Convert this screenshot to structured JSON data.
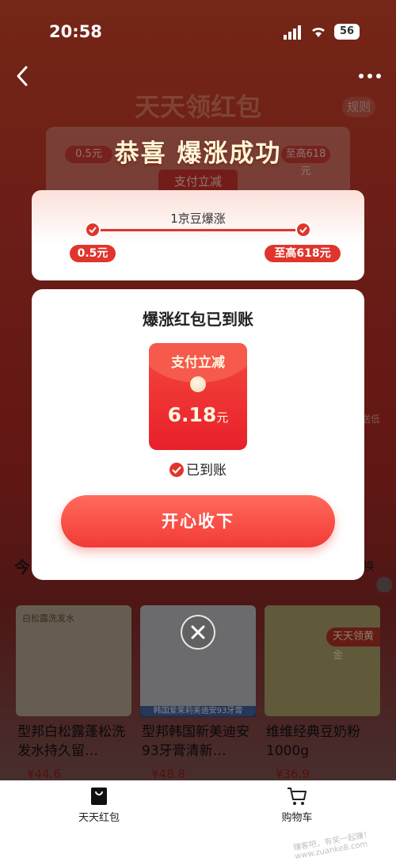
{
  "status_bar": {
    "time": "20:58",
    "battery": "56"
  },
  "header": {
    "title": "天天领红包",
    "rules_label": "规则",
    "back_icon": "chevron-left-icon",
    "more_icon": "more-dots-icon"
  },
  "background_card": {
    "low_value": "0.5元",
    "high_value": "至高618元",
    "button_label": "支付立减"
  },
  "congrats": {
    "title": "恭喜  爆涨成功"
  },
  "progress": {
    "label": "1京豆爆涨",
    "start_value": "0.5元",
    "end_value": "至高618元"
  },
  "reward": {
    "title": "爆涨红包已到账",
    "envelope_label": "支付立减",
    "amount": "6.18",
    "unit": "元",
    "received_label": "已到账",
    "accept_button": "开心收下"
  },
  "section": {
    "head_left": "今",
    "head_right": "换",
    "side_text": "送低"
  },
  "products": [
    {
      "tag": "白松露洗发水",
      "name": "型邦白松露蓬松洗发水持久留…",
      "price": "¥44.6"
    },
    {
      "caption": "韩国爱茉莉美迪安93牙膏",
      "name": "型邦韩国新美迪安93牙膏清新…",
      "price": "¥48.8"
    },
    {
      "badge": "天天领黄金",
      "name": "维维经典豆奶粉1000g",
      "price": "¥36.9"
    }
  ],
  "bottom_nav": {
    "left_label": "天天红包",
    "right_label": "购物车"
  },
  "watermark": "赚客吧，有奖一起赚！ www.zuanke8.com",
  "colors": {
    "accent_red": "#e0352c",
    "button_red": "#f23a36",
    "envelope_red": "#e8202a"
  }
}
